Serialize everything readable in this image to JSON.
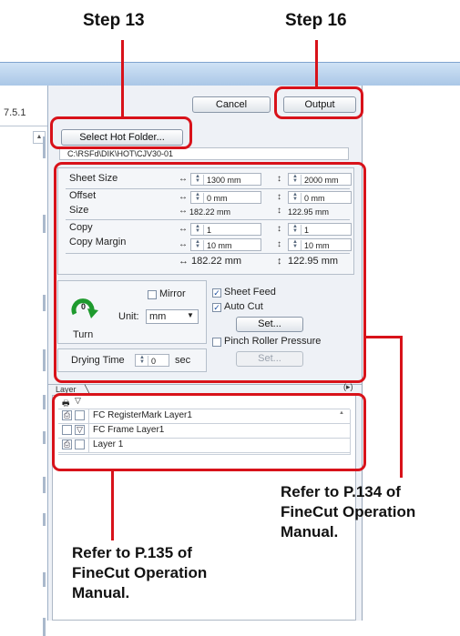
{
  "callouts": {
    "step13": "Step 13",
    "step16": "Step 16",
    "ref134": [
      "Refer to P.134 of",
      "FineCut Operation",
      "Manual."
    ],
    "ref135": [
      "Refer to P.135 of",
      "FineCut Operation",
      "Manual."
    ]
  },
  "window": {
    "version": "7.5.1",
    "cancel_label": "Cancel",
    "output_label": "Output",
    "select_hot_folder_label": "Select Hot Folder...",
    "hot_folder_path": "C:\\RSFd\\DIK\\HOT\\CJV30-01"
  },
  "size_section": {
    "sheet_size": {
      "label": "Sheet Size",
      "width": "1300 mm",
      "height": "2000 mm"
    },
    "offset": {
      "label": "Offset",
      "x": "0 mm",
      "y": "0 mm"
    },
    "size": {
      "label": "Size",
      "width": "182.22 mm",
      "height": "122.95 mm"
    },
    "copy": {
      "label": "Copy",
      "x": "1",
      "y": "1"
    },
    "copy_margin": {
      "label": "Copy Margin",
      "x": "10 mm",
      "y": "10 mm"
    },
    "total": {
      "width": "182.22 mm",
      "height": "122.95 mm"
    }
  },
  "options": {
    "mirror_label": "Mirror",
    "mirror_checked": false,
    "unit_label": "Unit:",
    "unit_value": "mm",
    "turn_label": "Turn",
    "turn_value": "0",
    "sheet_feed_label": "Sheet Feed",
    "sheet_feed_checked": true,
    "auto_cut_label": "Auto Cut",
    "auto_cut_checked": true,
    "set_label": "Set...",
    "pinch_roller_label": "Pinch Roller Pressure",
    "pinch_roller_checked": false,
    "drying_time_label": "Drying Time",
    "drying_time_value": "0",
    "drying_unit": "sec",
    "set2_label": "Set..."
  },
  "layer_panel": {
    "tab_label": "Layer",
    "expand_glyph": "(▸)",
    "layers": [
      {
        "name": "FC RegisterMark Layer1",
        "icon": "printer-icon"
      },
      {
        "name": "FC Frame Layer1",
        "icon": "cut-icon"
      },
      {
        "name": "Layer 1",
        "icon": "printer-icon"
      }
    ]
  },
  "colors": {
    "accent_red": "#d8121a",
    "arrow_green": "#1e9a2e"
  }
}
